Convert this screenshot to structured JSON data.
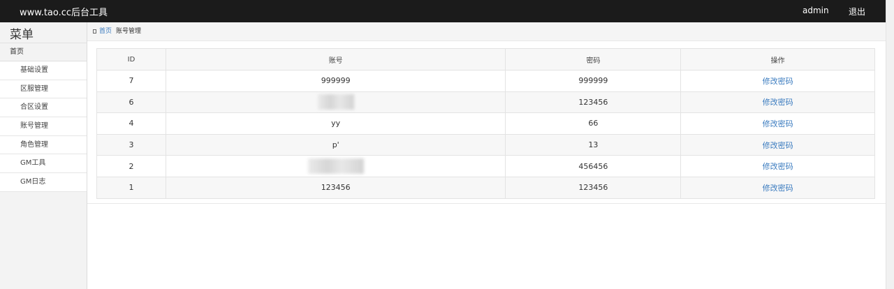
{
  "header": {
    "brand": "www.tao.cc后台工具",
    "user": "admin",
    "logout": "退出"
  },
  "sidebar": {
    "title": "菜单",
    "home": "首页",
    "items": [
      {
        "label": "基础设置"
      },
      {
        "label": "区服管理"
      },
      {
        "label": "合区设置"
      },
      {
        "label": "账号管理"
      },
      {
        "label": "角色管理"
      },
      {
        "label": "GM工具"
      },
      {
        "label": "GM日志"
      }
    ]
  },
  "breadcrumb": {
    "home": "首页",
    "current": "账号管理"
  },
  "table": {
    "headers": {
      "id": "ID",
      "account": "账号",
      "password": "密码",
      "action": "操作"
    },
    "action_label": "修改密码",
    "rows": [
      {
        "id": "7",
        "account": "999999",
        "password": "999999",
        "action": "修改密码"
      },
      {
        "id": "6",
        "account": "",
        "password": "123456",
        "action": "修改密码"
      },
      {
        "id": "4",
        "account": "yy",
        "password": "66",
        "action": "修改密码"
      },
      {
        "id": "3",
        "account": "p'",
        "password": "13",
        "action": "修改密码"
      },
      {
        "id": "2",
        "account": "",
        "password": "456456",
        "action": "修改密码"
      },
      {
        "id": "1",
        "account": "123456",
        "password": "123456",
        "action": "修改密码"
      }
    ]
  },
  "colors": {
    "topbar": "#1b1b1b",
    "link": "#3a7bbf",
    "sidebar": "#f3f3f3"
  }
}
